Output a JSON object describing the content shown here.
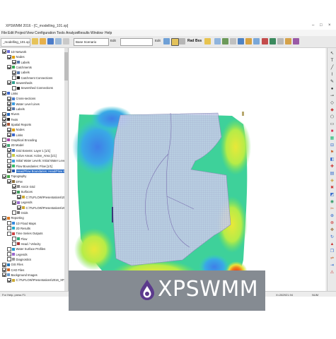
{
  "window": {
    "title": "XPSWMM 2016 - [C_modelling_101.xp]",
    "controls": [
      "–",
      "□",
      "×"
    ]
  },
  "menu": [
    "File",
    "Edit",
    "Project",
    "View",
    "Configuration",
    "Tools",
    "Analyze",
    "Results",
    "Window",
    "Help"
  ],
  "document_tab": "_modelling_101.xp",
  "toolbar": {
    "scenario": "Base Scenario",
    "edit_label": "Edit",
    "edit_label_2": "Edit",
    "lbl_rad": "Rad",
    "lbl_bss": "Bss"
  },
  "layers": [
    {
      "level": 0,
      "checked": true,
      "icon": "network-icon",
      "label": "1D Network"
    },
    {
      "level": 1,
      "checked": true,
      "icon": "node-icon",
      "label": "Nodes"
    },
    {
      "level": 2,
      "checked": true,
      "icon": "label-icon",
      "label": "Labels"
    },
    {
      "level": 1,
      "checked": true,
      "icon": "catchment-icon",
      "label": "Catchments"
    },
    {
      "level": 2,
      "checked": true,
      "icon": "label-icon",
      "label": "Labels"
    },
    {
      "level": 2,
      "checked": false,
      "icon": "connection-icon",
      "label": "Catchment Connections"
    },
    {
      "level": 1,
      "checked": true,
      "icon": "sewershed-icon",
      "label": "Sewersheds"
    },
    {
      "level": 2,
      "checked": false,
      "icon": "connection-icon",
      "label": "Sewershed Connections"
    },
    {
      "level": 0,
      "checked": true,
      "icon": "link-icon",
      "label": "Links"
    },
    {
      "level": 1,
      "checked": true,
      "icon": "cross-section-icon",
      "label": "Cross-sections"
    },
    {
      "level": 1,
      "checked": true,
      "icon": "water-level-icon",
      "label": "Water Level Lines"
    },
    {
      "level": 1,
      "checked": true,
      "icon": "label-icon",
      "label": "Labels"
    },
    {
      "level": 0,
      "checked": true,
      "icon": "river-icon",
      "label": "Rivers"
    },
    {
      "level": 0,
      "checked": true,
      "icon": "text-icon",
      "label": "Texts"
    },
    {
      "level": 0,
      "checked": true,
      "icon": "spatial-report-icon",
      "label": "Spatial Reports"
    },
    {
      "level": 1,
      "checked": true,
      "icon": "node-icon",
      "label": "Nodes"
    },
    {
      "level": 1,
      "checked": true,
      "icon": "link-icon",
      "label": "Links"
    },
    {
      "level": 0,
      "checked": false,
      "icon": "graphical-encoding-icon",
      "label": "Graphical Encoding"
    },
    {
      "level": 0,
      "checked": true,
      "icon": "model-2d-icon",
      "label": "2D Model"
    },
    {
      "level": 1,
      "checked": true,
      "icon": "grid-extents-icon",
      "label": "Grid Extents: Layer 1 [1/1]"
    },
    {
      "level": 1,
      "checked": false,
      "icon": "active-area-icon",
      "label": "Active Areas: Active_Area [1/1]"
    },
    {
      "level": 1,
      "checked": false,
      "icon": "water-level-icon",
      "label": "Initial Water Levels: Initial Water Level [0/1]"
    },
    {
      "level": 1,
      "checked": true,
      "icon": "flow-boundary-icon",
      "label": "Flow Boundaries: Flow [1/1]"
    },
    {
      "level": 1,
      "checked": true,
      "icon": "head-flow-icon",
      "label": "Head/Flow Boundaries: Head/Flow Boundary",
      "selected": true
    },
    {
      "level": 0,
      "checked": true,
      "icon": "topography-icon",
      "label": "Topography"
    },
    {
      "level": 1,
      "checked": true,
      "icon": "dtm-icon",
      "label": "DTM"
    },
    {
      "level": 2,
      "checked": true,
      "icon": "ascii-grid-icon",
      "label": "ASCII Grid"
    },
    {
      "level": 2,
      "checked": true,
      "icon": "surface-icon",
      "label": "Surfaces"
    },
    {
      "level": 3,
      "checked": true,
      "icon": "surface-file-icon",
      "label": "C:\\TUFLOW\\Presentations\\20..."
    },
    {
      "level": 2,
      "checked": true,
      "icon": "legend-icon",
      "label": "Legends"
    },
    {
      "level": 3,
      "checked": true,
      "icon": "surface-file-icon",
      "label": "C:\\TUFLOW\\Presentations\\20..."
    },
    {
      "level": 2,
      "checked": false,
      "icon": "grid-icon",
      "label": "Grids"
    },
    {
      "level": 0,
      "checked": true,
      "icon": "reporting-icon",
      "label": "Reporting"
    },
    {
      "level": 1,
      "checked": false,
      "icon": "flood-map-icon",
      "label": "1D Flood Maps"
    },
    {
      "level": 1,
      "checked": false,
      "icon": "results-2d-icon",
      "label": "2D Results"
    },
    {
      "level": 1,
      "checked": false,
      "icon": "time-series-icon",
      "label": "Time Series Outputs"
    },
    {
      "level": 2,
      "checked": false,
      "icon": "flow-icon",
      "label": "Flow"
    },
    {
      "level": 2,
      "checked": false,
      "icon": "velocity-icon",
      "label": "Head / Velocity"
    },
    {
      "level": 1,
      "checked": false,
      "icon": "water-surface-icon",
      "label": "Water Surface Profiles"
    },
    {
      "level": 1,
      "checked": false,
      "icon": "legend-icon",
      "label": "Legends"
    },
    {
      "level": 1,
      "checked": false,
      "icon": "diagnostics-icon",
      "label": "Diagnostics"
    },
    {
      "level": 0,
      "checked": true,
      "icon": "gis-icon",
      "label": "GIS Files"
    },
    {
      "level": 0,
      "checked": true,
      "icon": "cad-icon",
      "label": "CAD Files"
    },
    {
      "level": 0,
      "checked": true,
      "icon": "background-image-icon",
      "label": "Background Images"
    },
    {
      "level": 1,
      "checked": true,
      "icon": "image-file-icon",
      "label": "C:\\TUFLOW\\Presentations\\2016_XP_L..."
    }
  ],
  "status": {
    "help": "For Help, press F1",
    "coords": "X=282921.94",
    "units": "NUM"
  },
  "banner": {
    "brand": "XPSWMM"
  },
  "colors": {
    "accent": "#2a6cc5",
    "banner": "#858b92",
    "logo": "#5b3a8c"
  }
}
